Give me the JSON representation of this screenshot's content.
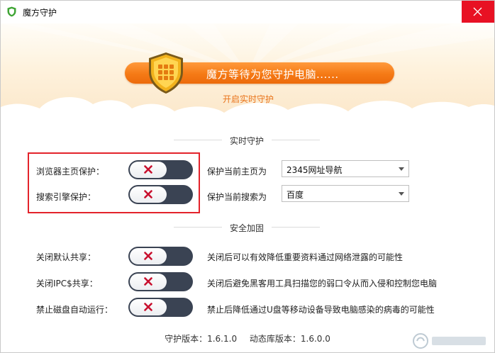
{
  "window": {
    "title": "魔方守护"
  },
  "banner": {
    "status_text": "魔方等待为您守护电脑......",
    "enable_link": "开启实时守护"
  },
  "realtime": {
    "section_title": "实时守护",
    "rows": [
      {
        "label": "浏览器主页保护：",
        "field_label": "保护当前主页为",
        "select_value": "2345网址导航",
        "enabled": false
      },
      {
        "label": "搜索引擎保护：",
        "field_label": "保护当前搜索为",
        "select_value": "百度",
        "enabled": false
      }
    ]
  },
  "security": {
    "section_title": "安全加固",
    "rows": [
      {
        "label": "关闭默认共享：",
        "description": "关闭后可以有效降低重要资料通过网络泄露的可能性",
        "enabled": false
      },
      {
        "label": "关闭IPC$共享：",
        "description": "关闭后避免黑客用工具扫描您的弱口令从而入侵和控制您电脑",
        "enabled": false
      },
      {
        "label": "禁止磁盘自动运行：",
        "description": "禁止后降低通过U盘等移动设备导致电脑感染的病毒的可能性",
        "enabled": false
      }
    ]
  },
  "footer": {
    "version": "守护版本：1.6.1.0",
    "lib_version": "动态库版本：1.6.0.0"
  },
  "colors": {
    "accent": "#f57a16",
    "close": "#e81123",
    "toggle_off": "#3a4353",
    "toggle_x": "#c8102e",
    "highlight": "#e3232b"
  }
}
